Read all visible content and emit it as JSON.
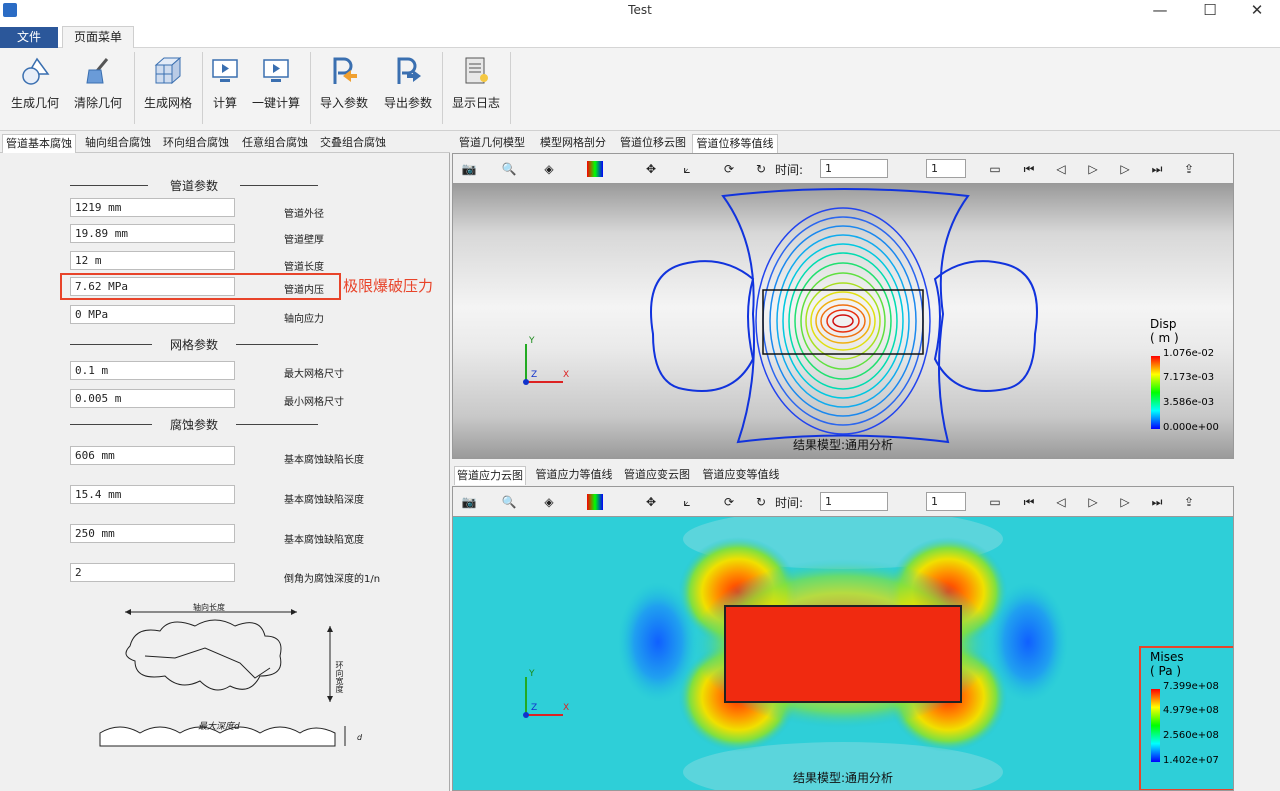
{
  "window": {
    "title": "Test",
    "min": "—",
    "max": "☐",
    "close": "✕"
  },
  "menu": {
    "file": "文件",
    "page": "页面菜单"
  },
  "ribbon": {
    "gen_geom": "生成几何",
    "clear_geom": "清除几何",
    "gen_mesh": "生成网格",
    "calc": "计算",
    "one_click": "一键计算",
    "import": "导入参数",
    "export": "导出参数",
    "log": "显示日志"
  },
  "left_tabs": [
    "管道基本腐蚀",
    "轴向组合腐蚀",
    "环向组合腐蚀",
    "任意组合腐蚀",
    "交叠组合腐蚀"
  ],
  "pipe": {
    "title": "管道参数",
    "od_val": "1219 mm",
    "od_lbl": "管道外径",
    "wt_val": "19.89 mm",
    "wt_lbl": "管道壁厚",
    "len_val": "12 m",
    "len_lbl": "管道长度",
    "p_val": "7.62 MPa",
    "p_lbl": "管道内压",
    "ax_val": "0 MPa",
    "ax_lbl": "轴向应力"
  },
  "annotation": "极限爆破压力",
  "mesh": {
    "title": "网格参数",
    "max_val": "0.1 m",
    "max_lbl": "最大网格尺寸",
    "min_val": "0.005 m",
    "min_lbl": "最小网格尺寸"
  },
  "corr": {
    "title": "腐蚀参数",
    "len_val": "606 mm",
    "len_lbl": "基本腐蚀缺陷长度",
    "dep_val": "15.4 mm",
    "dep_lbl": "基本腐蚀缺陷深度",
    "wid_val": "250 mm",
    "wid_lbl": "基本腐蚀缺陷宽度",
    "ch_val": "2",
    "ch_lbl": "倒角为腐蚀深度的1/n"
  },
  "diagram": {
    "axial": "轴向长度",
    "circ": "环向宽度",
    "depth": "最大深度d",
    "d": "d"
  },
  "top_tabs": [
    "管道几何模型",
    "模型网格剖分",
    "管道位移云图",
    "管道位移等值线"
  ],
  "bottom_tabs": [
    "管道应力云图",
    "管道应力等值线",
    "管道应变云图",
    "管道应变等值线"
  ],
  "toolbar": {
    "time": "时间:",
    "time_val": "1",
    "step_val": "1"
  },
  "top_view": {
    "caption": "结果模型:通用分析",
    "legend_title": "Disp",
    "legend_unit": "( m )",
    "labels": [
      "1.076e-02",
      "7.173e-03",
      "3.586e-03",
      "0.000e+00"
    ],
    "axes": {
      "y": "Y",
      "z": "Z",
      "x": "X"
    }
  },
  "bottom_view": {
    "caption": "结果模型:通用分析",
    "legend_title": "Mises",
    "legend_unit": "( Pa )",
    "labels": [
      "7.399e+08",
      "4.979e+08",
      "2.560e+08",
      "1.402e+07"
    ],
    "axes": {
      "y": "Y",
      "z": "Z",
      "x": "X"
    }
  },
  "colors": {
    "accent": "#2b579a",
    "highlight": "#e8442a"
  }
}
